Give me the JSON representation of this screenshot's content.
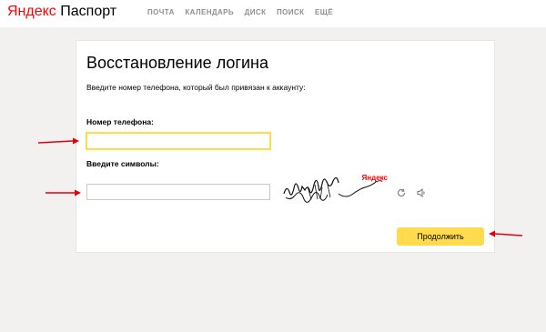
{
  "header": {
    "logo_brand": "Яндекс",
    "logo_product": "Паспорт",
    "nav": [
      "ПОЧТА",
      "КАЛЕНДАРЬ",
      "ДИСК",
      "ПОИСК",
      "ЕЩЁ"
    ]
  },
  "form": {
    "title": "Восстановление логина",
    "subtitle": "Введите номер телефона, который был привязан к аккаунту:",
    "phone_label": "Номер телефона:",
    "phone_value": "",
    "captcha_label": "Введите символы:",
    "captcha_value": "",
    "captcha_brand": "Яндекс",
    "submit_label": "Продолжить"
  },
  "icons": {
    "refresh": "refresh-icon",
    "audio": "speaker-icon",
    "annotation": "red-arrow-icon"
  },
  "colors": {
    "accent": "#ffdb4d",
    "brand_red": "#ff0000",
    "annotation": "#e3000b"
  }
}
